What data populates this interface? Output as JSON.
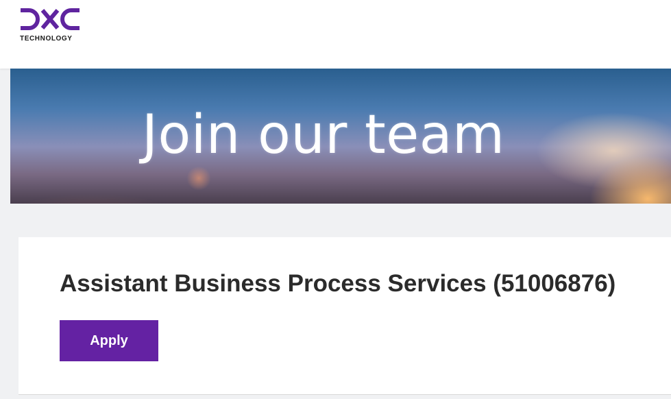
{
  "header": {
    "logo_text": "DXC",
    "logo_subtext": "TECHNOLOGY",
    "brand_color": "#5f249f"
  },
  "banner": {
    "headline": "Join our team"
  },
  "job": {
    "title": "Assistant Business Process Services (51006876)",
    "apply_label": "Apply",
    "button_color": "#6422a3"
  }
}
